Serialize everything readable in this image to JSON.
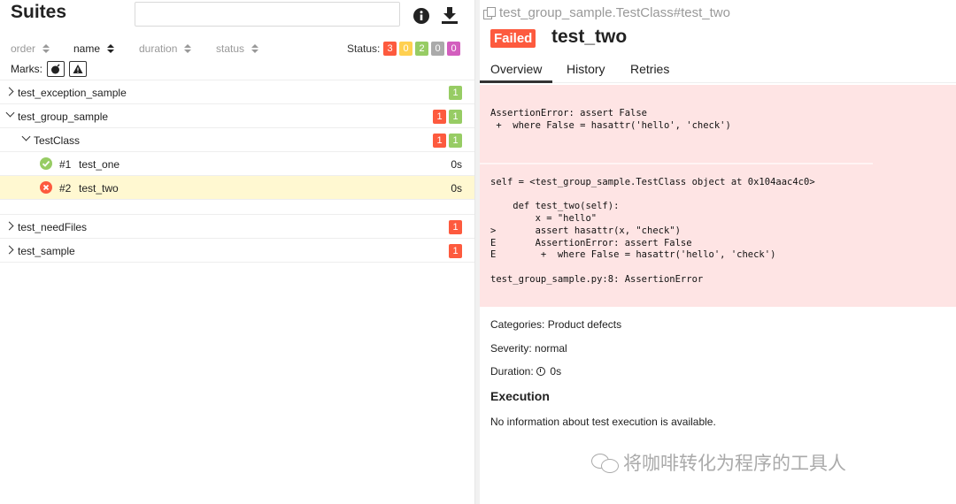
{
  "suites": {
    "title": "Suites",
    "search_placeholder": ""
  },
  "sort": {
    "order": "order",
    "name": "name",
    "duration": "duration",
    "status": "status",
    "status_label": "Status:",
    "status_counts": {
      "failed": "3",
      "broken": "0",
      "passed": "2",
      "skipped": "0",
      "unknown": "0"
    }
  },
  "marks": {
    "label": "Marks:"
  },
  "tree": {
    "exception_sample": {
      "label": "test_exception_sample",
      "passed": "1"
    },
    "group_sample": {
      "label": "test_group_sample",
      "failed": "1",
      "passed": "1"
    },
    "test_class": {
      "label": "TestClass",
      "failed": "1",
      "passed": "1"
    },
    "test_one": {
      "num": "#1",
      "label": "test_one",
      "duration": "0s"
    },
    "test_two": {
      "num": "#2",
      "label": "test_two",
      "duration": "0s"
    },
    "need_files": {
      "label": "test_needFiles",
      "failed": "1"
    },
    "sample": {
      "label": "test_sample",
      "failed": "1"
    }
  },
  "detail": {
    "full_name": "test_group_sample.TestClass#test_two",
    "status": "Failed",
    "title": "test_two",
    "tabs": [
      "Overview",
      "History",
      "Retries"
    ],
    "error_message": "AssertionError: assert False\n +  where False = hasattr('hello', 'check')",
    "trace": "self = <test_group_sample.TestClass object at 0x104aac4c0>\n\n    def test_two(self):\n        x = \"hello\"\n>       assert hasattr(x, \"check\")\nE       AssertionError: assert False\nE        +  where False = hasattr('hello', 'check')\n\ntest_group_sample.py:8: AssertionError",
    "categories": "Categories: Product defects",
    "severity": "Severity: normal",
    "duration_label": "Duration:",
    "duration_value": "0s",
    "execution_title": "Execution",
    "execution_text": "No information about test execution is available."
  },
  "watermark": "将咖啡转化为程序的工具人",
  "colors": {
    "failed": "#fd5a3e",
    "broken": "#ffd050",
    "passed": "#97cc64",
    "skipped": "#aaaaaa",
    "unknown": "#d35ebe",
    "error_bg": "#fee4e4",
    "selected_bg": "#fff8d1"
  }
}
